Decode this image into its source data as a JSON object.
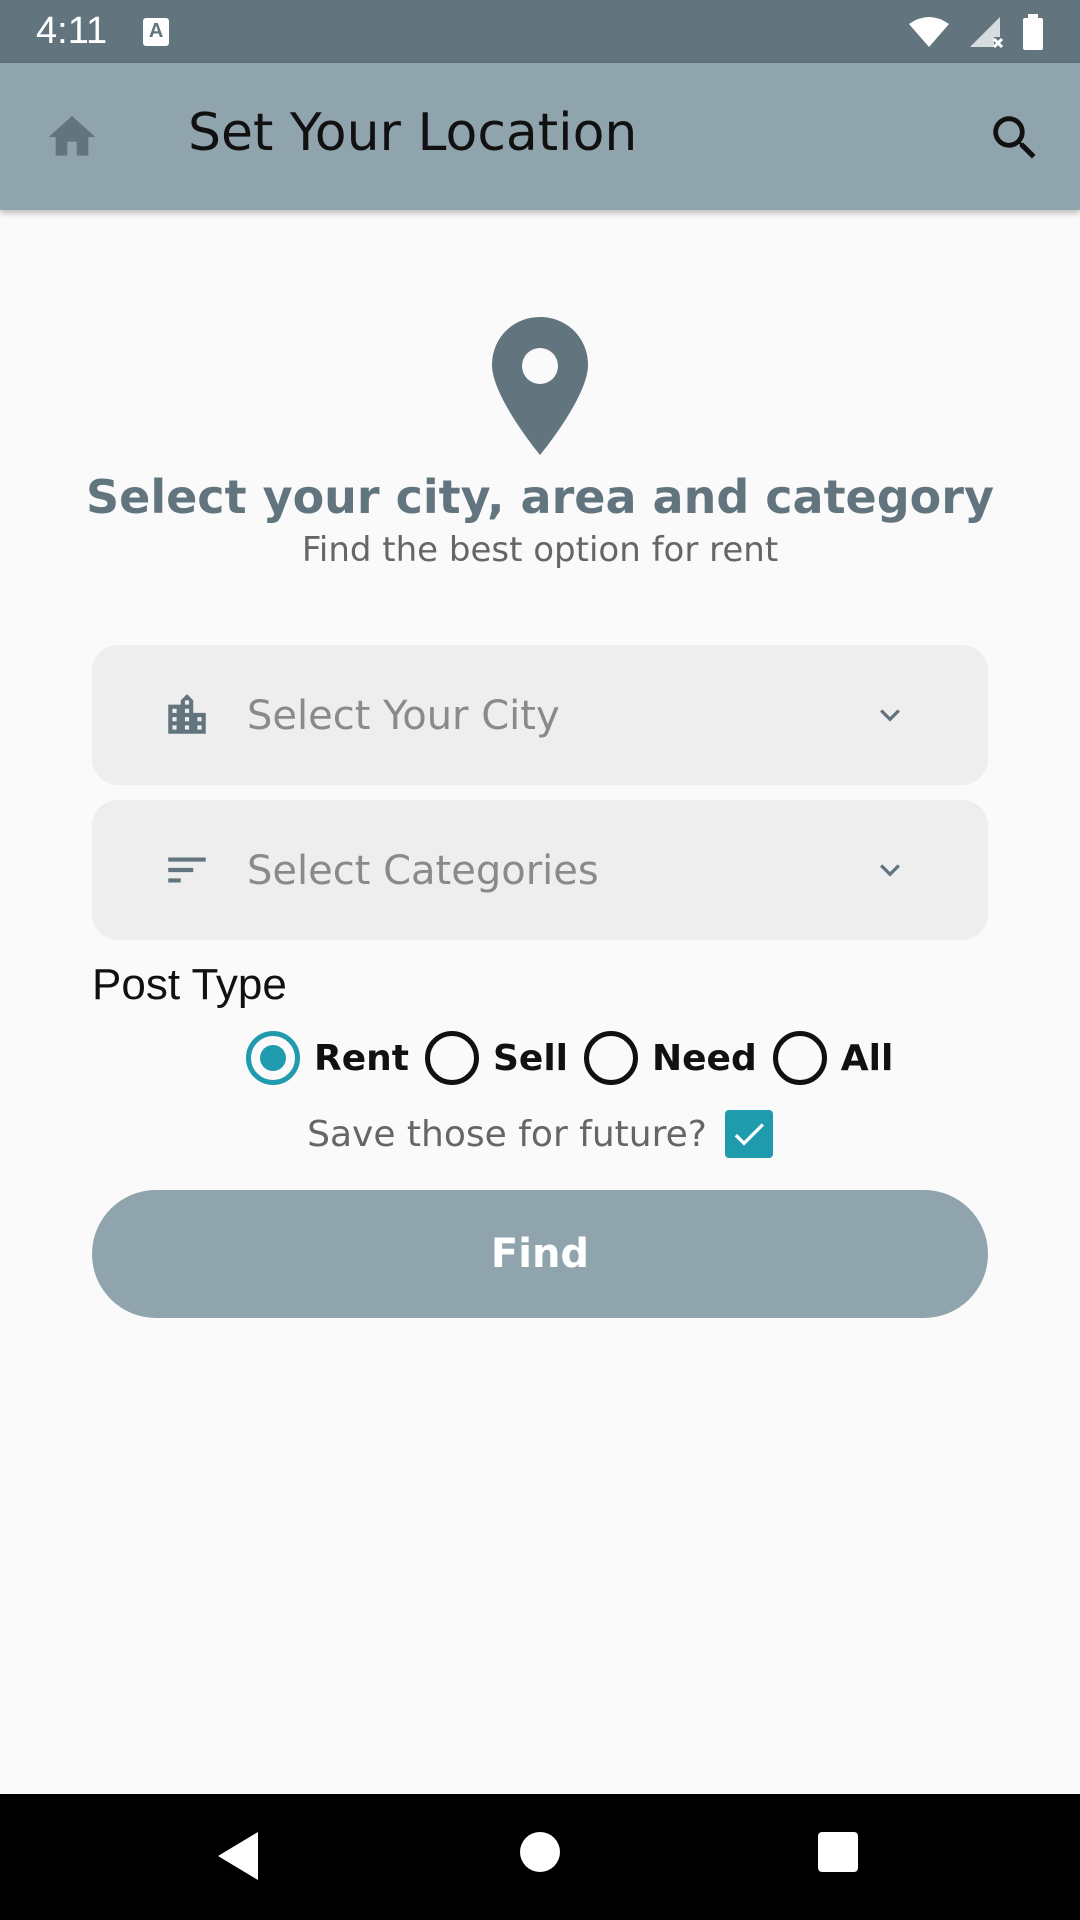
{
  "status_bar": {
    "time": "4:11",
    "notification_icon": "a-keyboard-icon",
    "icons": [
      "wifi-icon",
      "signal-icon",
      "battery-icon"
    ]
  },
  "app_bar": {
    "title": "Set Your Location",
    "home_icon": "home-icon",
    "search_icon": "search-icon"
  },
  "main": {
    "headline": "Select your city, area and category",
    "subline": "Find the best option for rent",
    "city_select": {
      "placeholder": "Select Your City",
      "icon": "city-icon"
    },
    "category_select": {
      "placeholder": "Select Categories",
      "icon": "sort-icon"
    },
    "post_type": {
      "label": "Post Type",
      "options": [
        {
          "label": "Rent",
          "checked": true
        },
        {
          "label": "Sell",
          "checked": false
        },
        {
          "label": "Need",
          "checked": false
        },
        {
          "label": "All",
          "checked": false
        }
      ]
    },
    "save": {
      "label": "Save those for future?",
      "checked": true
    },
    "find_button": "Find"
  },
  "colors": {
    "status_bar": "#62757f",
    "app_bar": "#90a4ae",
    "accent": "#1f9bad",
    "button": "#90a4ae"
  }
}
